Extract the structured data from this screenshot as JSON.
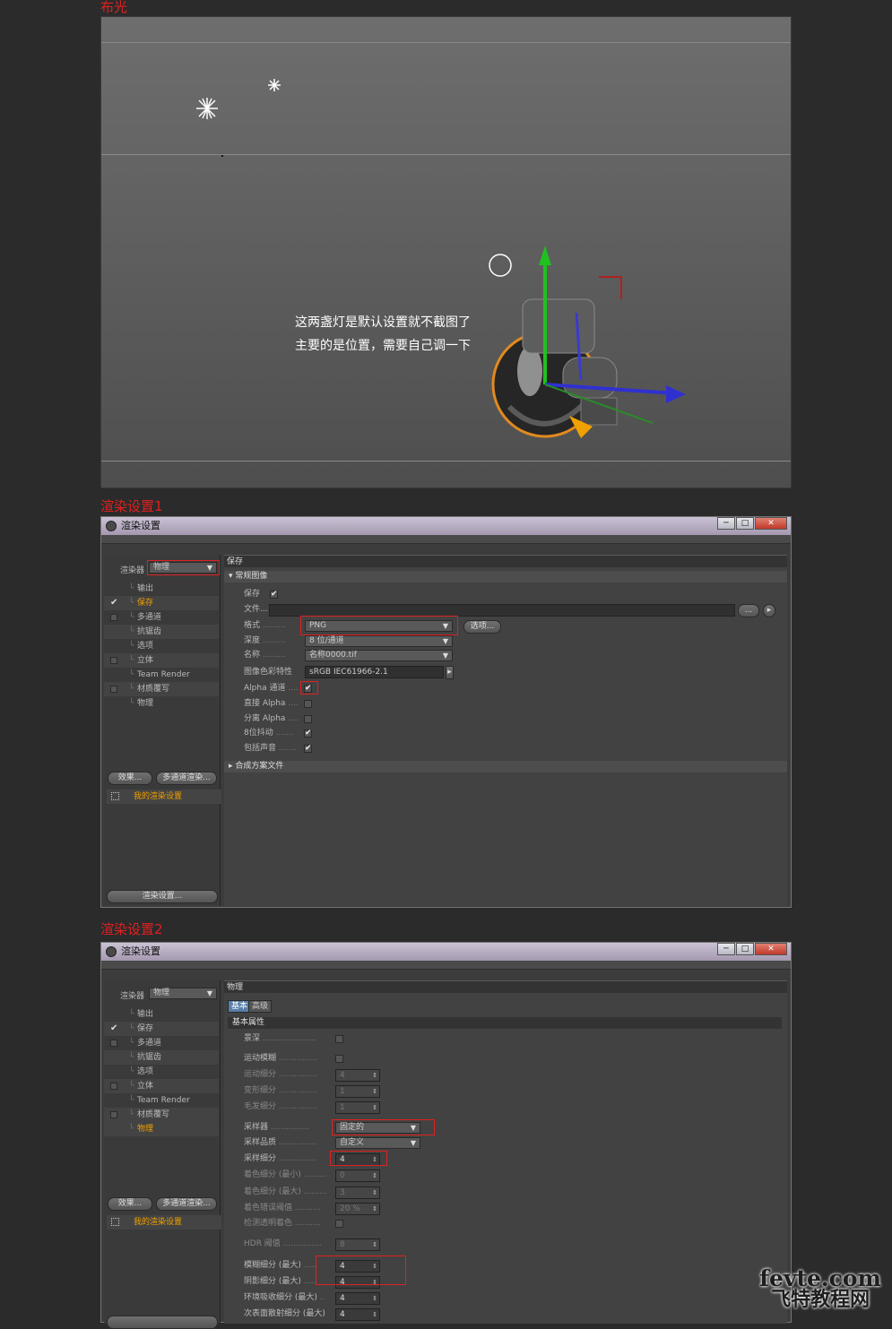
{
  "section1": {
    "title": "布光"
  },
  "viewport": {
    "caption_line1": "这两盏灯是默认设置就不截图了",
    "caption_line2": "主要的是位置，需要自己调一下"
  },
  "section2": {
    "title": "渲染设置1"
  },
  "section3": {
    "title": "渲染设置2"
  },
  "window": {
    "title": "渲染设置",
    "min": "─",
    "max": "□",
    "close": "✕",
    "renderer_label": "渲染器",
    "renderer_value": "物理",
    "nav": [
      {
        "label": "输出"
      },
      {
        "label": "保存",
        "checked": true
      },
      {
        "label": "多通道",
        "checkbox": true
      },
      {
        "label": "抗锯齿"
      },
      {
        "label": "选项"
      },
      {
        "label": "立体",
        "checkbox": true
      },
      {
        "label": "Team Render"
      },
      {
        "label": "材质覆写",
        "checkbox": true
      },
      {
        "label": "物理"
      }
    ],
    "effects_button": "效果...",
    "multipass_button": "多通道渲染...",
    "config_name": "我的渲染设置",
    "render_settings_button": "渲染设置..."
  },
  "panel1": {
    "header": "保存",
    "group": "常规图像",
    "save_label": "保存",
    "file_label": "文件...",
    "file_browse": "...",
    "format_label": "格式",
    "format_value": "PNG",
    "options_button": "选项...",
    "depth_label": "深度",
    "depth_value": "8 位/通道",
    "name_label": "名称",
    "name_value": "名称0000.tif",
    "profile_label": "图像色彩特性",
    "profile_value": "sRGB IEC61966-2.1",
    "alpha_label": "Alpha 通道",
    "straight_alpha_label": "直接 Alpha",
    "separate_alpha_label": "分离 Alpha",
    "dither_label": "8位抖动",
    "sound_label": "包括声音",
    "composite_group": "合成方案文件"
  },
  "panel2": {
    "header": "物理",
    "tab_basic": "基本",
    "tab_advanced": "高级",
    "group": "基本属性",
    "dof_label": "景深",
    "motion_blur_label": "运动模糊",
    "motion_subdiv_label": "运动细分",
    "motion_subdiv_value": "4",
    "deform_subdiv_label": "变形细分",
    "deform_subdiv_value": "1",
    "hair_subdiv_label": "毛发细分",
    "hair_subdiv_value": "1",
    "sampler_label": "采样器",
    "sampler_value": "固定的",
    "quality_label": "采样品质",
    "quality_value": "自定义",
    "sample_subdiv_label": "采样细分",
    "sample_subdiv_value": "4",
    "shading_min_label": "着色细分 (最小)",
    "shading_min_value": "0",
    "shading_max_label": "着色细分 (最大)",
    "shading_max_value": "3",
    "shading_err_label": "着色错误阈值",
    "shading_err_value": "20 %",
    "detect_label": "检测透明着色",
    "hdr_label": "HDR 阈值",
    "hdr_value": "8",
    "blur_max_label": "模糊细分 (最大)",
    "blur_max_value": "4",
    "shadow_max_label": "阴影细分 (最大)",
    "shadow_max_value": "4",
    "ao_max_label": "环境吸收细分 (最大)",
    "ao_max_value": "4",
    "sss_max_label": "次表面散射细分 (最大)",
    "sss_max_value": "4"
  },
  "watermark": {
    "line1": "fevte.com",
    "line2": "飞特教程网"
  }
}
